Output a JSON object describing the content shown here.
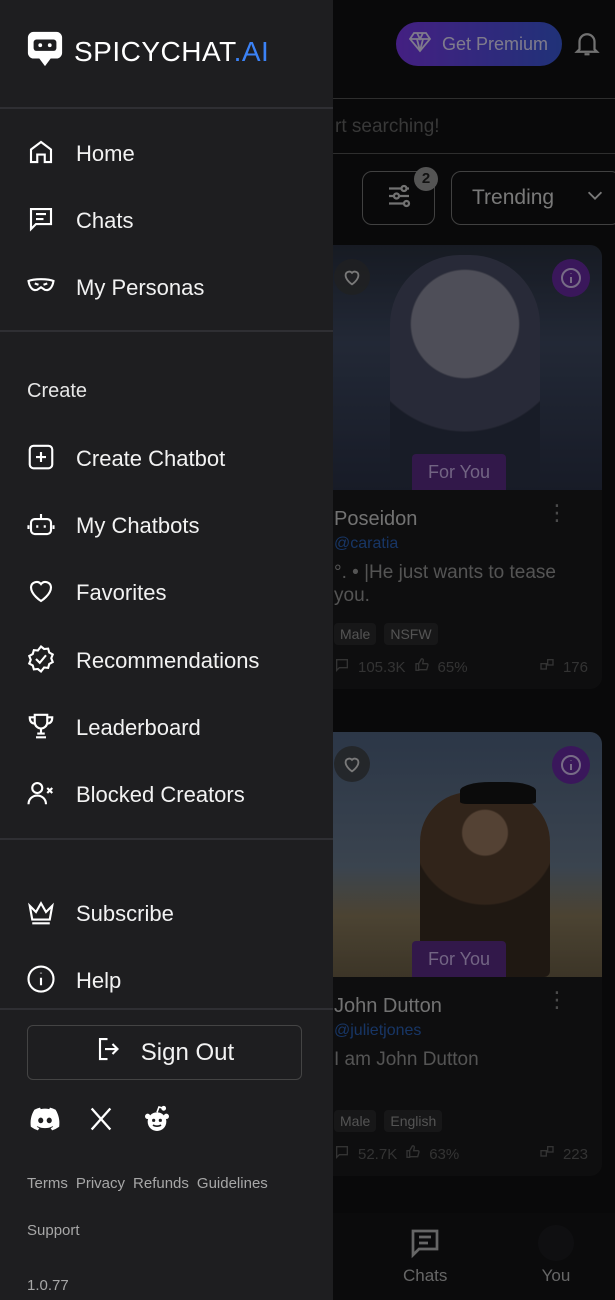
{
  "brand": {
    "name": "SPICYCHAT",
    "suffix": ".AI",
    "accent": "#3b82f6"
  },
  "drawer": {
    "nav": [
      {
        "label": "Home",
        "icon": "home-icon"
      },
      {
        "label": "Chats",
        "icon": "chat-icon"
      },
      {
        "label": "My Personas",
        "icon": "mask-icon"
      }
    ],
    "create_title": "Create",
    "create_items": [
      {
        "label": "Create Chatbot",
        "icon": "plus-square-icon"
      },
      {
        "label": "My Chatbots",
        "icon": "robot-icon"
      },
      {
        "label": "Favorites",
        "icon": "heart-icon"
      },
      {
        "label": "Recommendations",
        "icon": "badge-check-icon"
      },
      {
        "label": "Leaderboard",
        "icon": "trophy-icon"
      },
      {
        "label": "Blocked Creators",
        "icon": "user-x-icon"
      }
    ],
    "bottom_items": [
      {
        "label": "Subscribe",
        "icon": "crown-icon"
      },
      {
        "label": "Help",
        "icon": "info-icon"
      }
    ],
    "sign_out_label": "Sign Out",
    "links": [
      "Terms",
      "Privacy",
      "Refunds",
      "Guidelines"
    ],
    "support_label": "Support",
    "version": "1.0.77"
  },
  "background": {
    "premium_label": "Get Premium",
    "search_placeholder": "rt searching!",
    "filter_count": "2",
    "sort_value": "Trending",
    "cards": [
      {
        "name": "Poseidon",
        "username": "@caratia",
        "description": "°. • |He just wants to tease you.",
        "badge": "For You",
        "tags": [
          "Male",
          "NSFW"
        ],
        "messages": "105.3K",
        "likes": "65%",
        "count": "176"
      },
      {
        "name": "John Dutton",
        "username": "@julietjones",
        "description": "I am John Dutton",
        "badge": "For You",
        "tags": [
          "Male",
          "English"
        ],
        "messages": "52.7K",
        "likes": "63%",
        "count": "223"
      }
    ],
    "bottom_nav": [
      {
        "label": "Chats"
      },
      {
        "label": "You"
      }
    ]
  }
}
